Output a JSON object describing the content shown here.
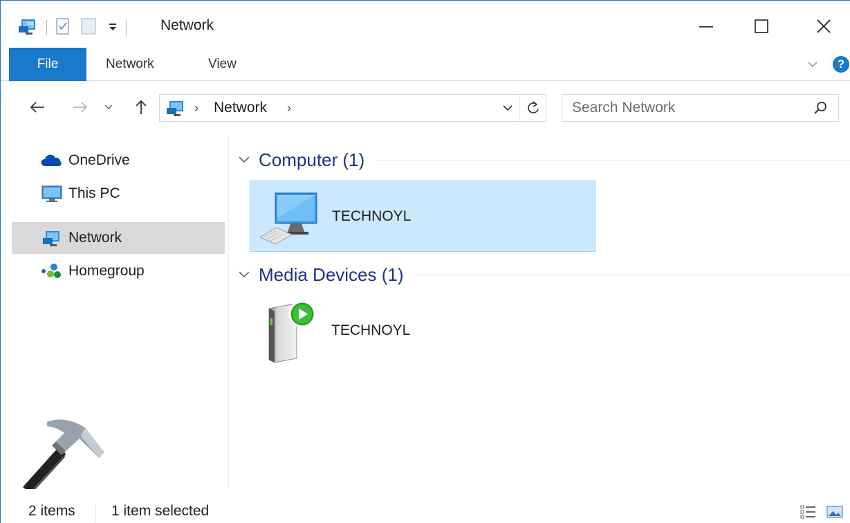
{
  "window": {
    "title": "Network"
  },
  "ribbon": {
    "tabs": [
      {
        "label": "File"
      },
      {
        "label": "Network"
      },
      {
        "label": "View"
      }
    ],
    "help_label": "?"
  },
  "address": {
    "crumbs": [
      "Network"
    ],
    "search_placeholder": "Search Network"
  },
  "nav_pane": {
    "items": [
      {
        "label": "OneDrive",
        "icon": "onedrive-icon"
      },
      {
        "label": "This PC",
        "icon": "this-pc-icon"
      },
      {
        "label": "Network",
        "icon": "network-icon",
        "selected": true
      },
      {
        "label": "Homegroup",
        "icon": "homegroup-icon"
      }
    ]
  },
  "content": {
    "groups": [
      {
        "header": "Computer (1)",
        "items": [
          {
            "label": "TECHNOYL",
            "icon": "computer-icon",
            "selected": true
          }
        ]
      },
      {
        "header": "Media Devices (1)",
        "items": [
          {
            "label": "TECHNOYL",
            "icon": "media-device-icon",
            "selected": false
          }
        ]
      }
    ]
  },
  "status": {
    "item_count": "2 items",
    "selection": "1 item selected"
  },
  "colors": {
    "accent": "#1979ca",
    "selection_bg": "#cce8ff",
    "group_header": "#1e3287"
  }
}
